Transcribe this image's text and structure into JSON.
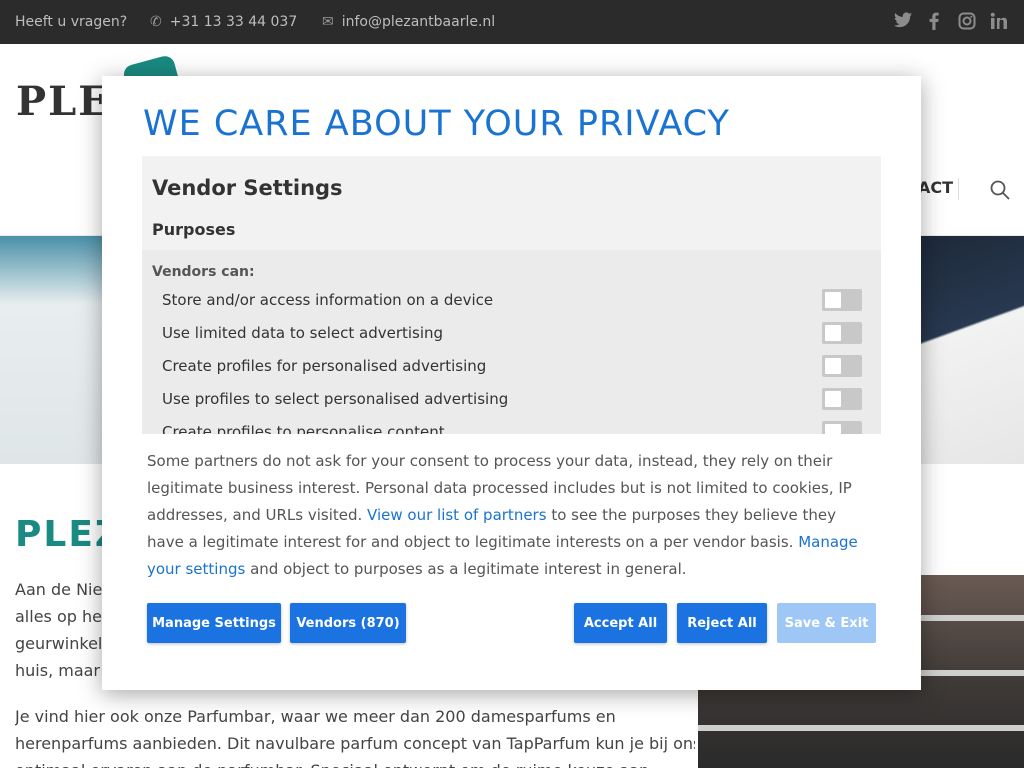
{
  "topbar": {
    "question": "Heeft u vragen?",
    "phone": "+31 13 33 44 037",
    "email": "info@plezantbaarle.nl",
    "phone_icon": "phone-icon",
    "mail_icon": "mail-icon",
    "social": [
      "twitter-icon",
      "facebook-icon",
      "instagram-icon",
      "linkedin-icon"
    ]
  },
  "header": {
    "logo_text": "PLE",
    "nav_tail": "ACT"
  },
  "background_content": {
    "title": "PLEZ",
    "p1_lines": [
      "Aan de Nieu",
      "alles op het",
      "geurwinkel v",
      "huis, maar c"
    ],
    "p2_lines": [
      "Je vind hier ook onze Parfumbar, waar we meer dan 200 damesparfums en",
      "herenparfums aanbieden. Dit navulbare parfum concept van TapParfum kun je bij ons",
      "optimaal ervaren aan de parfumbar. Speciaal ontwerpt om de ruime keuze aan"
    ]
  },
  "modal": {
    "title": "WE CARE ABOUT YOUR PRIVACY",
    "vendor_settings": {
      "heading": "Vendor Settings",
      "purposes_heading": "Purposes",
      "vendors_can": "Vendors can:",
      "purposes": [
        {
          "label": "Store and/or access information on a device",
          "enabled": false
        },
        {
          "label": "Use limited data to select advertising",
          "enabled": false
        },
        {
          "label": "Create profiles for personalised advertising",
          "enabled": false
        },
        {
          "label": "Use profiles to select personalised advertising",
          "enabled": false
        },
        {
          "label": "Create profiles to personalise content",
          "enabled": false
        }
      ]
    },
    "info": {
      "text_1": "Some partners do not ask for your consent to process your data, instead, they rely on their legitimate business interest. Personal data processed includes but is not limited to cookies, IP addresses, and URLs visited. ",
      "link_partners": "View our list of partners",
      "text_2": " to see the purposes they believe they have a legitimate interest for and object to legitimate interests on a per vendor basis. ",
      "link_settings": "Manage your settings",
      "text_3": " and object to purposes as a legitimate interest in general."
    },
    "buttons": {
      "manage": "Manage Settings",
      "vendors": "Vendors (870)",
      "accept": "Accept All",
      "reject": "Reject All",
      "save": "Save & Exit"
    },
    "colors": {
      "accent": "#1a73e0",
      "title": "#1a73d0",
      "disabled_button": "#9ec7f5"
    }
  }
}
